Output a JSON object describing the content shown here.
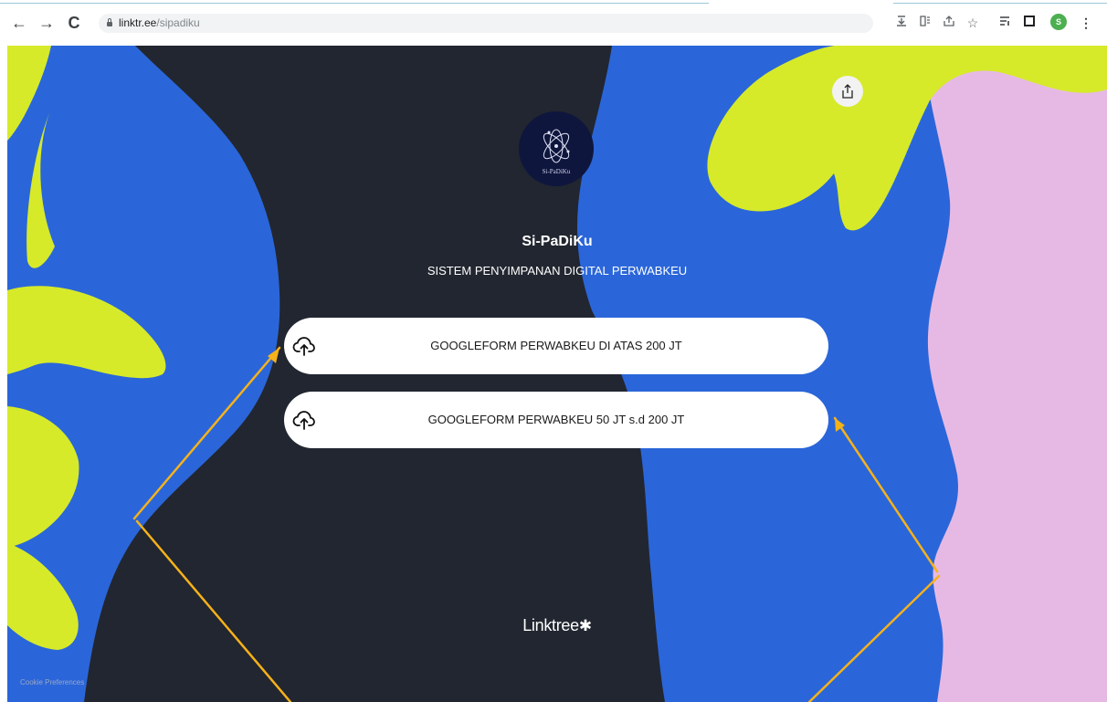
{
  "browser": {
    "nav": {
      "back_icon": "←",
      "forward_icon": "→",
      "reload_icon": "C"
    },
    "address_bar": {
      "host": "linktr.ee",
      "path": "/sipadiku"
    },
    "toolbar_icons": [
      "download-icon",
      "reader-icon",
      "share-icon",
      "bookmark-star-icon",
      "reading-list-icon",
      "side-panel-icon",
      "profile-avatar-icon",
      "menu-icon"
    ],
    "profile_initial": "S"
  },
  "profile": {
    "avatar_caption": "Si-PaDiKu",
    "name": "Si-PaDiKu",
    "description": "SISTEM PENYIMPANAN DIGITAL PERWABKEU"
  },
  "links": [
    {
      "label": "GOOGLEFORM PERWABKEU DI ATAS 200 JT",
      "icon": "cloud-upload-icon"
    },
    {
      "label": "GOOGLEFORM PERWABKEU 50 JT s.d 200 JT",
      "icon": "cloud-upload-icon"
    }
  ],
  "footer": {
    "brand": "Linktree",
    "brand_mark": "✱",
    "cookie_link": "Cookie Preferences"
  },
  "colors": {
    "page_blue": "#2a66d9",
    "dark_silhouette": "#222630",
    "leaf_yellow": "#d6ea2a",
    "pink": "#e6b9e4",
    "arrow_annotation": "#f6b21a"
  }
}
